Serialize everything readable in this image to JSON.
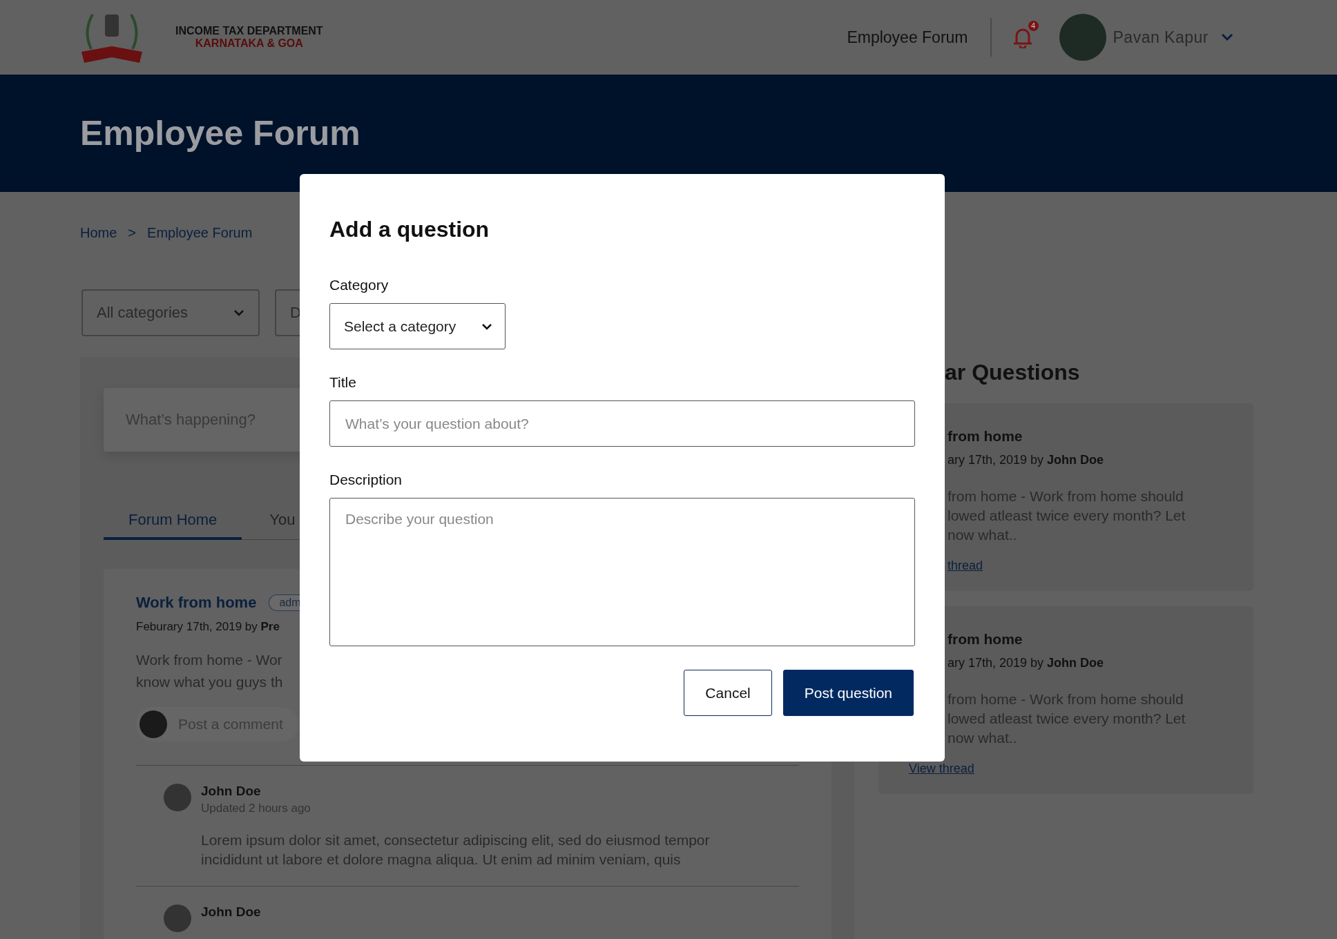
{
  "header": {
    "logo_title": "INCOME TAX DEPARTMENT",
    "logo_subtitle": "KARNATAKA & GOA",
    "nav_link": "Employee Forum",
    "notification_count": "4",
    "user_name": "Pavan Kapur"
  },
  "banner": {
    "title": "Employee Forum"
  },
  "breadcrumb": {
    "separator": ">",
    "items": [
      {
        "label": "Home"
      },
      {
        "label": "Employee Forum"
      }
    ]
  },
  "filters": [
    {
      "value": "All categories"
    },
    {
      "value": "D"
    }
  ],
  "composer": {
    "placeholder": "What’s happening?"
  },
  "tabs": [
    {
      "label": "Forum Home",
      "selected": true
    },
    {
      "label": "You",
      "selected": false
    }
  ],
  "post": {
    "title": "Work from home",
    "badge": "adm",
    "meta": "Feburary 17th, 2019 by **Pre**",
    "body_lines": [
      "Work from home - Wor",
      "know what you guys th"
    ],
    "comment_placeholder": "Post a comment",
    "comments": [
      {
        "author": "John Doe",
        "time": "Updated 2 hours ago",
        "text_lines": [
          "Lorem ipsum dolor sit amet, consectetur adipiscing elit, sed do eiusmod tempor",
          "incididunt ut labore et dolore magna aliqua. Ut enim ad minim veniam, quis"
        ]
      },
      {
        "author": "John Doe"
      }
    ]
  },
  "popular": {
    "title": "ar Questions",
    "cards": [
      {
        "title": "from home",
        "meta": "ary 17th, 2019 by **John Doe**",
        "body_lines": [
          "from home - Work from home should",
          "lowed atleast twice every month? Let",
          "now what.."
        ],
        "link": "thread"
      },
      {
        "title": "from home",
        "meta": "ary 17th, 2019 by **John Doe**",
        "body_lines": [
          "from home - Work from home should",
          "lowed atleast twice every month? Let",
          "now what.."
        ],
        "link": "View thread"
      }
    ]
  },
  "modal": {
    "title": "Add a question",
    "fields": [
      {
        "kind": "select",
        "label": "Category",
        "value": "Select a category"
      },
      {
        "kind": "input",
        "label": "Title",
        "placeholder": "What’s your question about?"
      },
      {
        "kind": "textarea",
        "label": "Description",
        "placeholder": "Describe your question"
      }
    ],
    "buttons": [
      {
        "kind": "secondary",
        "label": "Cancel"
      },
      {
        "kind": "primary",
        "label": "Post question"
      }
    ]
  }
}
